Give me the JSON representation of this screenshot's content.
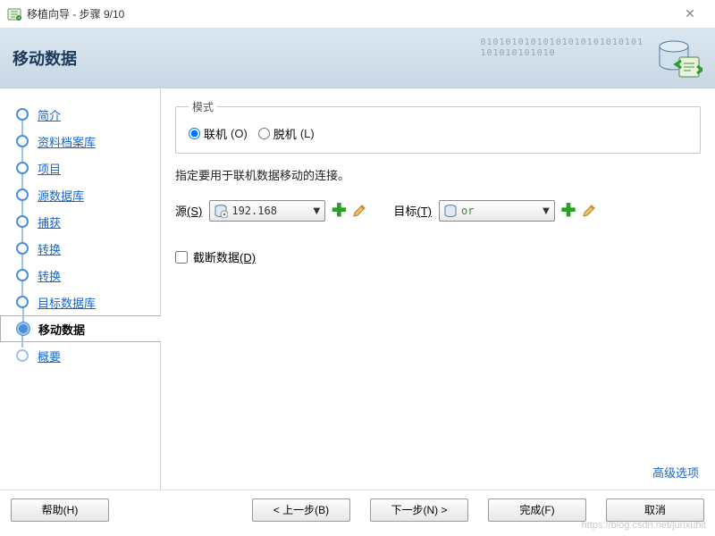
{
  "window": {
    "title": "移植向导 - 步骤 9/10"
  },
  "banner": {
    "title": "移动数据"
  },
  "sidebar": {
    "items": [
      {
        "label": "简介",
        "state": "done"
      },
      {
        "label": "资料档案库",
        "state": "done"
      },
      {
        "label": "项目",
        "state": "done"
      },
      {
        "label": "源数据库",
        "state": "done"
      },
      {
        "label": "捕获 ",
        "state": "done"
      },
      {
        "label": "转换",
        "state": "done"
      },
      {
        "label": "转换",
        "state": "done"
      },
      {
        "label": "目标数据库",
        "state": "done"
      },
      {
        "label": "移动数据",
        "state": "current"
      },
      {
        "label": "概要",
        "state": "pending"
      }
    ]
  },
  "mode": {
    "legend": "模式",
    "online_label": "联机",
    "online_mnemo": "(O)",
    "offline_label": "脱机",
    "offline_mnemo": "(L)",
    "selected": "online"
  },
  "instruction": "指定要用于联机数据移动的连接。",
  "conn": {
    "source_label": "源",
    "source_mnemo": "(S)",
    "source_value": "192.168",
    "target_label": "目标",
    "target_mnemo": "(T)",
    "target_value": "or"
  },
  "truncate": {
    "label": "截断数据",
    "mnemo": "(D)",
    "checked": false
  },
  "advanced": "高级选项",
  "buttons": {
    "help": "帮助(H)",
    "back": "< 上一步(B)",
    "next": "下一步(N) >",
    "finish": "完成(F)",
    "cancel": "取消"
  },
  "watermark": "https://blog.csdn.net/junxuhit"
}
